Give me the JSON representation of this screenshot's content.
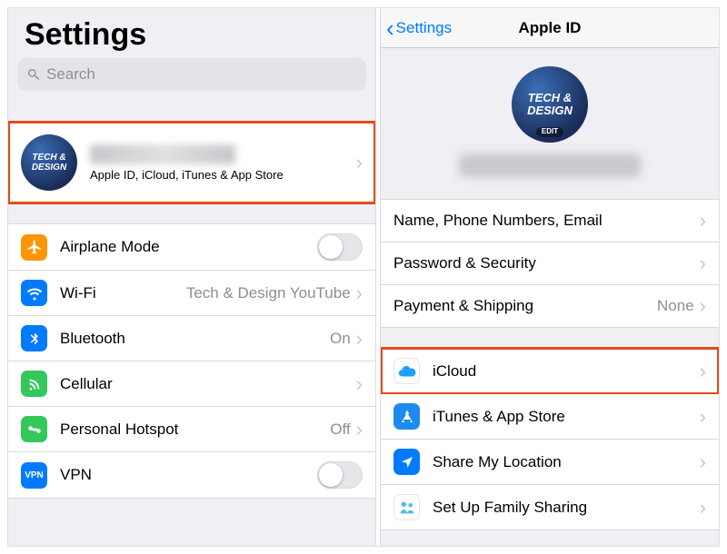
{
  "left": {
    "title": "Settings",
    "search_placeholder": "Search",
    "profile": {
      "avatar_text": "TECH & DESIGN",
      "subtitle": "Apple ID, iCloud, iTunes & App Store"
    },
    "rows": {
      "airplane": "Airplane Mode",
      "wifi": {
        "label": "Wi-Fi",
        "value": "Tech & Design YouTube"
      },
      "bluetooth": {
        "label": "Bluetooth",
        "value": "On"
      },
      "cellular": "Cellular",
      "hotspot": {
        "label": "Personal Hotspot",
        "value": "Off"
      },
      "vpn": {
        "label": "VPN",
        "badge": "VPN"
      }
    }
  },
  "right": {
    "back": "Settings",
    "title": "Apple ID",
    "avatar_text": "TECH & DESIGN",
    "avatar_edit": "EDIT",
    "group1": {
      "name": "Name, Phone Numbers, Email",
      "password": "Password & Security",
      "payment": {
        "label": "Payment & Shipping",
        "value": "None"
      }
    },
    "group2": {
      "icloud": "iCloud",
      "itunes": "iTunes & App Store",
      "share": "Share My Location",
      "family": "Set Up Family Sharing"
    }
  },
  "colors": {
    "airplane": "#ff9500",
    "wifi": "#007aff",
    "bluetooth": "#007aff",
    "cellular": "#34c759",
    "hotspot": "#34c759",
    "vpn": "#007aff",
    "icloud": "#1ea0ff",
    "itunes": "#1e8af0",
    "share": "#007aff",
    "family": "#55b8f2"
  }
}
